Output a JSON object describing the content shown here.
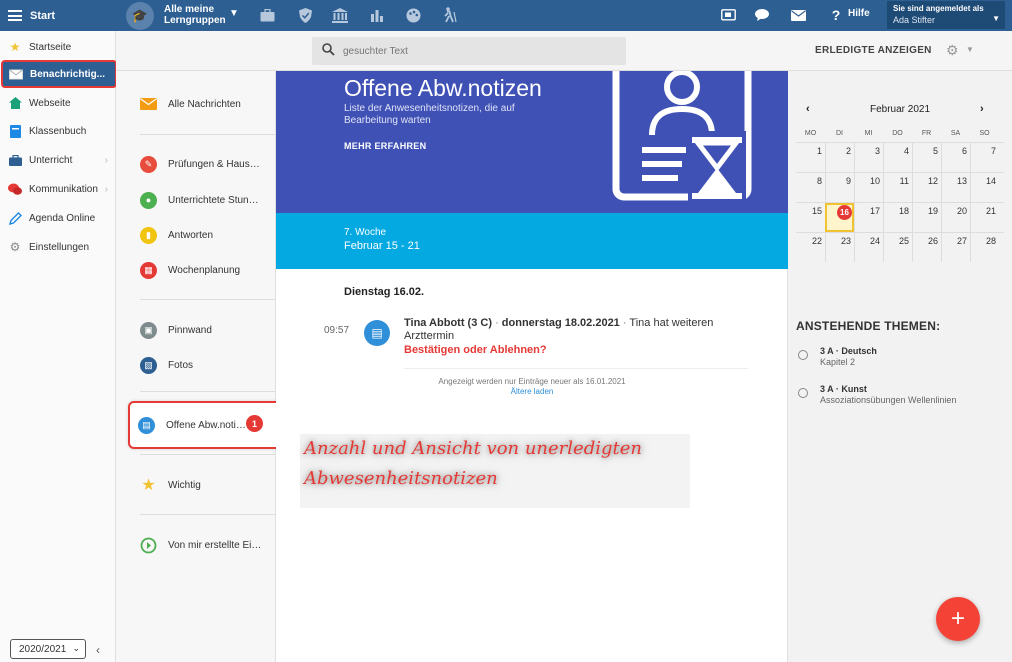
{
  "topbar": {
    "start_label": "Start",
    "group_name": "Alle meine Lerngruppen",
    "help_label": "Hilfe",
    "user_line1": "Sie sind angemeldet als",
    "user_name": "Ada Stifter"
  },
  "sidebar": {
    "items": [
      {
        "label": "Startseite",
        "icon": "star-icon"
      },
      {
        "label": "Benachrichtig...",
        "icon": "envelope-icon"
      },
      {
        "label": "Webseite",
        "icon": "home-icon"
      },
      {
        "label": "Klassenbuch",
        "icon": "book-icon"
      },
      {
        "label": "Unterricht",
        "icon": "briefcase-icon"
      },
      {
        "label": "Kommunikation",
        "icon": "chat-icon"
      },
      {
        "label": "Agenda Online",
        "icon": "pencil-icon"
      },
      {
        "label": "Einstellungen",
        "icon": "gear-icon"
      }
    ],
    "year": "2020/2021"
  },
  "header": {
    "search_placeholder": "gesuchter Text",
    "show_done_label": "ERLEDIGTE ANZEIGEN"
  },
  "nav": {
    "items": [
      {
        "label": "Alle Nachrichten",
        "color": "#f39c12"
      },
      {
        "label": "Prüfungen & Hausaufgaben",
        "color": "#e74c3c"
      },
      {
        "label": "Unterrichtete Stunden",
        "color": "#4caf50"
      },
      {
        "label": "Antworten",
        "color": "#f1c40f"
      },
      {
        "label": "Wochenplanung",
        "color": "#e53935"
      },
      {
        "label": "Pinnwand",
        "color": "#7f8c8d"
      },
      {
        "label": "Fotos",
        "color": "#2d5f92"
      },
      {
        "label": "Offene Abw.notizen",
        "color": "#2f8fd8",
        "badge": "1"
      },
      {
        "label": "Wichtig",
        "color": "#f1c232"
      },
      {
        "label": "Von mir erstellte Einträge",
        "color": "#4caf50"
      }
    ]
  },
  "main": {
    "hero_title": "Offene Abw.notizen",
    "hero_subtitle": "Liste der Anwesenheitsnotizen, die auf Bearbeitung warten",
    "hero_link": "MEHR ERFAHREN",
    "week_label": "7. Woche",
    "week_range": "Februar 15 - 21",
    "day_title": "Dienstag 16.02.",
    "entry": {
      "time": "09:57",
      "name": "Tina Abbott (3 C)",
      "date": "donnerstag 18.02.2021",
      "text": "Tina hat weiteren Arzttermin",
      "action": "Bestätigen oder Ablehnen?"
    },
    "older_note": "Angezeigt werden nur Einträge neuer als 16.01.2021",
    "older_link": "Ältere laden"
  },
  "annotation": {
    "line1": "Anzahl und Ansicht von unerledigten",
    "line2": "Abwesenheitsnotizen"
  },
  "calendar": {
    "month": "Februar 2021",
    "weekdays": [
      "MO",
      "DI",
      "MI",
      "DO",
      "FR",
      "SA",
      "SO"
    ],
    "weeks": [
      [
        "1",
        "2",
        "3",
        "4",
        "5",
        "6",
        "7"
      ],
      [
        "8",
        "9",
        "10",
        "11",
        "12",
        "13",
        "14"
      ],
      [
        "15",
        "16",
        "17",
        "18",
        "19",
        "20",
        "21"
      ],
      [
        "22",
        "23",
        "24",
        "25",
        "26",
        "27",
        "28"
      ]
    ],
    "today": "16"
  },
  "themes": {
    "title": "ANSTEHENDE THEMEN:",
    "items": [
      {
        "title": "3 A · Deutsch",
        "subtitle": "Kapitel 2"
      },
      {
        "title": "3 A · Kunst",
        "subtitle": "Assoziationsübungen Wellenlinien"
      }
    ]
  },
  "colors": {
    "topbar": "#2d5f92",
    "hero": "#3f51b5",
    "weekbar": "#03a9e0",
    "accent_red": "#e53935"
  }
}
